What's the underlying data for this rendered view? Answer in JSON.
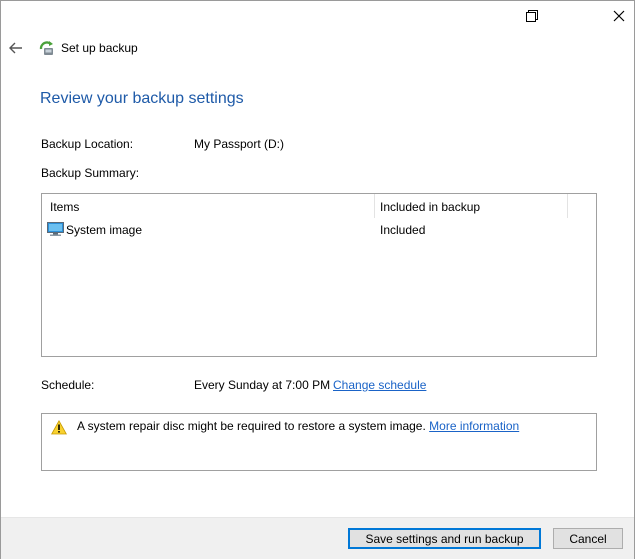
{
  "window": {
    "restore_icon": "restore-window-icon",
    "close_icon": "close-icon"
  },
  "nav": {
    "title": "Set up backup",
    "back_icon": "back-arrow-icon",
    "app_icon": "backup-icon"
  },
  "main": {
    "heading": "Review your backup settings",
    "location_label": "Backup Location:",
    "location_value": "My Passport (D:)",
    "summary_label": "Backup Summary:",
    "table": {
      "columns": [
        "Items",
        "Included in backup"
      ],
      "rows": [
        {
          "icon": "monitor-icon",
          "item": "System image",
          "status": "Included"
        }
      ]
    },
    "schedule_label": "Schedule:",
    "schedule_value": "Every Sunday at 7:00 PM",
    "change_schedule_link": "Change schedule",
    "warning": {
      "icon": "warning-icon",
      "text": "A system repair disc might be required to restore a system image.",
      "link": "More information"
    }
  },
  "footer": {
    "save_button": "Save settings and run backup",
    "cancel_button": "Cancel"
  },
  "colors": {
    "heading": "#1e5aa8",
    "link": "#1a63c7",
    "primary_border": "#0078d7",
    "footer_bg": "#f0f0f0"
  }
}
